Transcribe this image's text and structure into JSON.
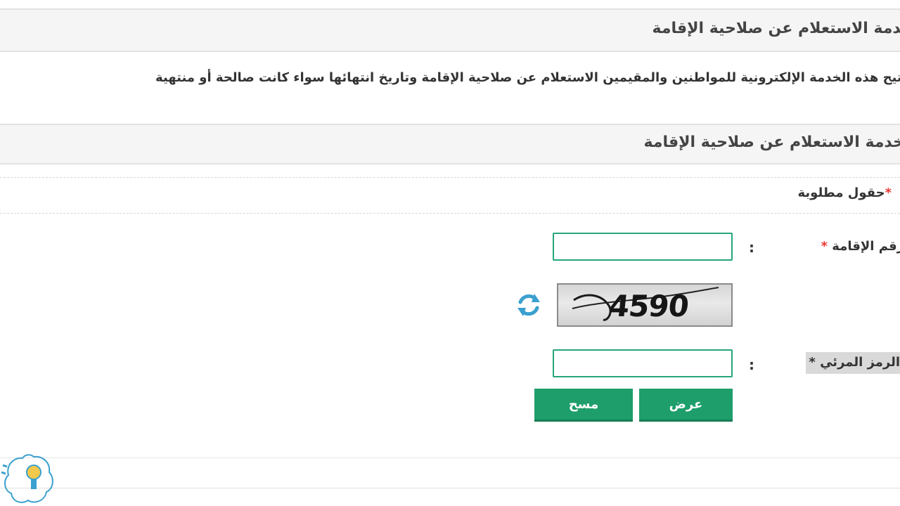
{
  "page": {
    "header_title": "خدمة الاستعلام عن صلاحية الإقامة",
    "description": "تتيح هذه الخدمة الإلكترونية للمواطنين والمقيمين الاستعلام عن صلاحية الإقامة وتاريخ انتهائها سواء كانت صالحة أو منتهية"
  },
  "form": {
    "section_title": "خدمة الاستعلام عن صلاحية الإقامة",
    "required_star": "*",
    "required_note": "حقول مطلوبة",
    "iqama_label": "رقم الإقامة",
    "iqama_value": "",
    "colon": ":",
    "captcha_text": "4590",
    "captcha_label": "الرمز المرئي",
    "captcha_value": "",
    "submit_label": "عرض",
    "clear_label": "مسح"
  },
  "icons": {
    "refresh": "refresh-icon",
    "logo": "lightbulb-logo"
  },
  "colors": {
    "accent": "#1e9e6b",
    "input_border": "#26a67a",
    "required": "#e53935",
    "refresh": "#3aa0cf"
  }
}
